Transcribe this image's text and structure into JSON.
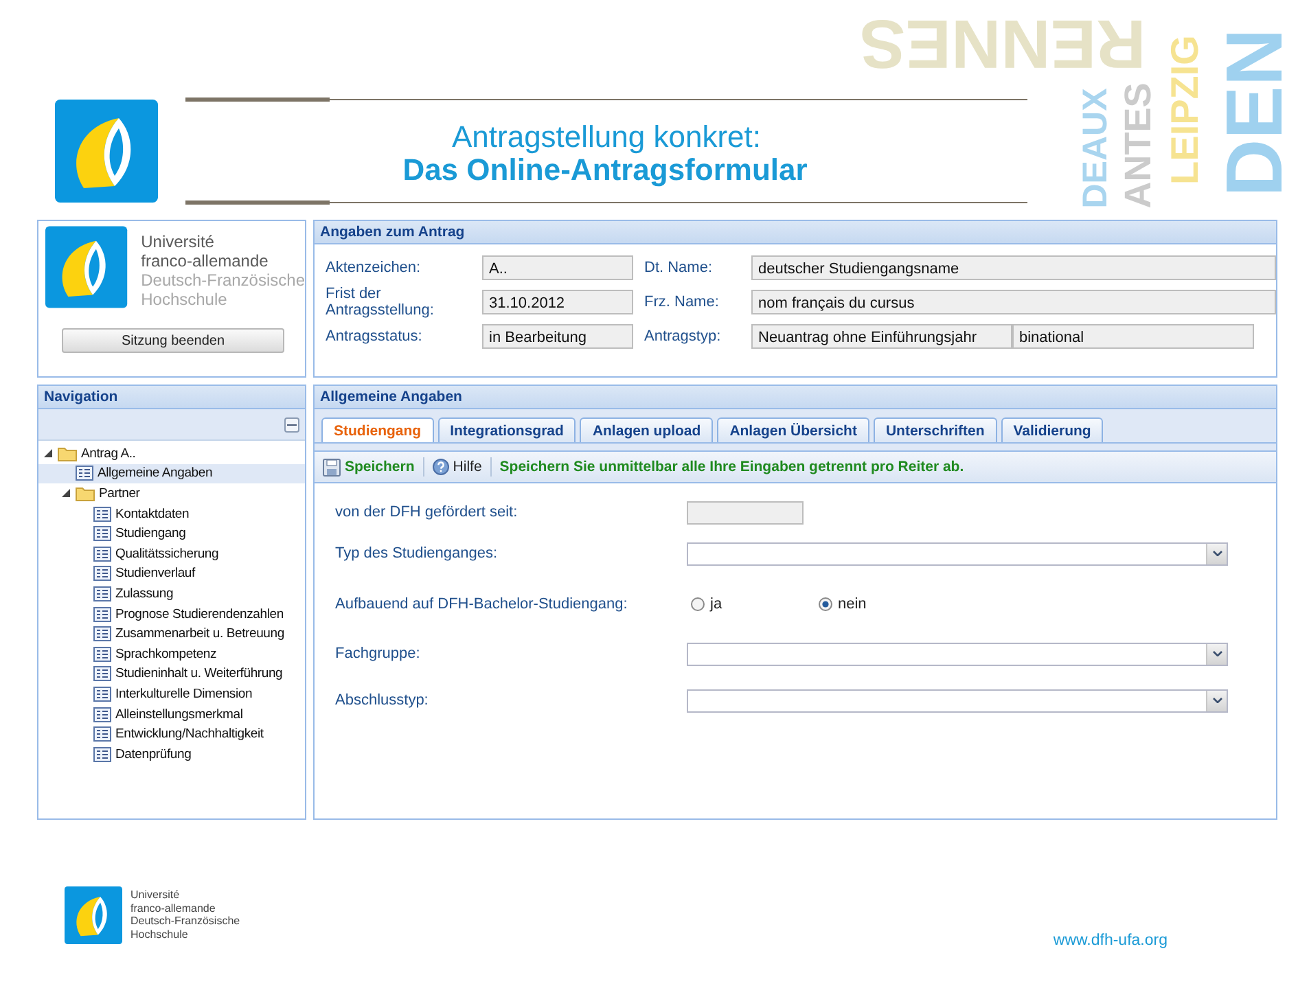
{
  "slide": {
    "title_line1": "Antragstellung konkret:",
    "title_line2": "Das Online-Antragsformular",
    "url": "www.dfh-ufa.org",
    "footer_logo_lines": [
      "Université",
      "franco-allemande",
      "Deutsch-Französische",
      "Hochschule"
    ]
  },
  "decoration": {
    "words": [
      {
        "text": "RENNES",
        "color": "#e6e2c6"
      },
      {
        "text": "DEAUX",
        "color": "#a9d5ef"
      },
      {
        "text": "ANTES",
        "color": "#cbcbcb"
      },
      {
        "text": "LEIPZIG",
        "color": "#f6e391"
      },
      {
        "text": "DEN",
        "color": "#9fd1ef"
      }
    ]
  },
  "app": {
    "brand": {
      "lines": [
        "Université",
        "franco-allemande",
        "Deutsch-Französische",
        "Hochschule"
      ],
      "logout_button": "Sitzung beenden"
    },
    "request_panel": {
      "title": "Angaben zum Antrag",
      "fields": [
        {
          "label": "Aktenzeichen:",
          "values": [
            "A.."
          ]
        },
        {
          "label": "Dt. Name:",
          "values": [
            "deutscher Studiengangsname"
          ]
        },
        {
          "label": "Frist der Antragsstellung:",
          "values": [
            "31.10.2012"
          ]
        },
        {
          "label": "Frz. Name:",
          "values": [
            "nom français du cursus"
          ]
        },
        {
          "label": "Antragsstatus:",
          "values": [
            "in Bearbeitung"
          ]
        },
        {
          "label": "Antragstyp:",
          "values": [
            "Neuantrag ohne Einführungsjahr",
            "binational"
          ]
        }
      ]
    },
    "navigation": {
      "title": "Navigation",
      "tree": [
        {
          "label": "Antrag A..",
          "kind": "folder",
          "expanded": true,
          "selected": false,
          "children": [
            {
              "label": "Allgemeine Angaben",
              "kind": "page",
              "selected": true
            },
            {
              "label": "Partner",
              "kind": "folder",
              "expanded": true,
              "selected": false,
              "children": [
                {
                  "label": "Kontaktdaten",
                  "kind": "page",
                  "selected": false
                },
                {
                  "label": "Studiengang",
                  "kind": "page",
                  "selected": false
                },
                {
                  "label": "Qualitätssicherung",
                  "kind": "page",
                  "selected": false
                },
                {
                  "label": "Studienverlauf",
                  "kind": "page",
                  "selected": false
                },
                {
                  "label": "Zulassung",
                  "kind": "page",
                  "selected": false
                },
                {
                  "label": "Prognose Studierendenzahlen",
                  "kind": "page",
                  "selected": false
                },
                {
                  "label": "Zusammenarbeit u. Betreuung",
                  "kind": "page",
                  "selected": false
                },
                {
                  "label": "Sprachkompetenz",
                  "kind": "page",
                  "selected": false
                },
                {
                  "label": "Studieninhalt u. Weiterführung",
                  "kind": "page",
                  "selected": false
                },
                {
                  "label": "Interkulturelle Dimension",
                  "kind": "page",
                  "selected": false
                },
                {
                  "label": "Alleinstellungsmerkmal",
                  "kind": "page",
                  "selected": false
                },
                {
                  "label": "Entwicklung/Nachhaltigkeit",
                  "kind": "page",
                  "selected": false
                },
                {
                  "label": "Datenprüfung",
                  "kind": "page",
                  "selected": false
                }
              ]
            }
          ]
        }
      ]
    },
    "main_panel": {
      "title": "Allgemeine Angaben",
      "tabs": [
        {
          "label": "Studiengang",
          "selected": true
        },
        {
          "label": "Integrationsgrad",
          "selected": false
        },
        {
          "label": "Anlagen upload",
          "selected": false
        },
        {
          "label": "Anlagen Übersicht",
          "selected": false
        },
        {
          "label": "Unterschriften",
          "selected": false
        },
        {
          "label": "Validierung",
          "selected": false
        }
      ],
      "toolbar": {
        "save": "Speichern",
        "help": "Hilfe",
        "message": "Speichern Sie unmittelbar alle Ihre Eingaben getrennt pro Reiter ab."
      },
      "form": [
        {
          "kind": "text",
          "label": "von der DFH gefördert seit:"
        },
        {
          "kind": "select",
          "label": "Typ des Studienganges:"
        },
        {
          "kind": "radio",
          "label": "Aufbauend auf DFH-Bachelor-Studiengang:",
          "options": [
            {
              "label": "ja",
              "selected": false
            },
            {
              "label": "nein",
              "selected": true
            }
          ]
        },
        {
          "kind": "select",
          "label": "Fachgruppe:"
        },
        {
          "kind": "select",
          "label": "Abschlusstyp:"
        }
      ]
    }
  }
}
